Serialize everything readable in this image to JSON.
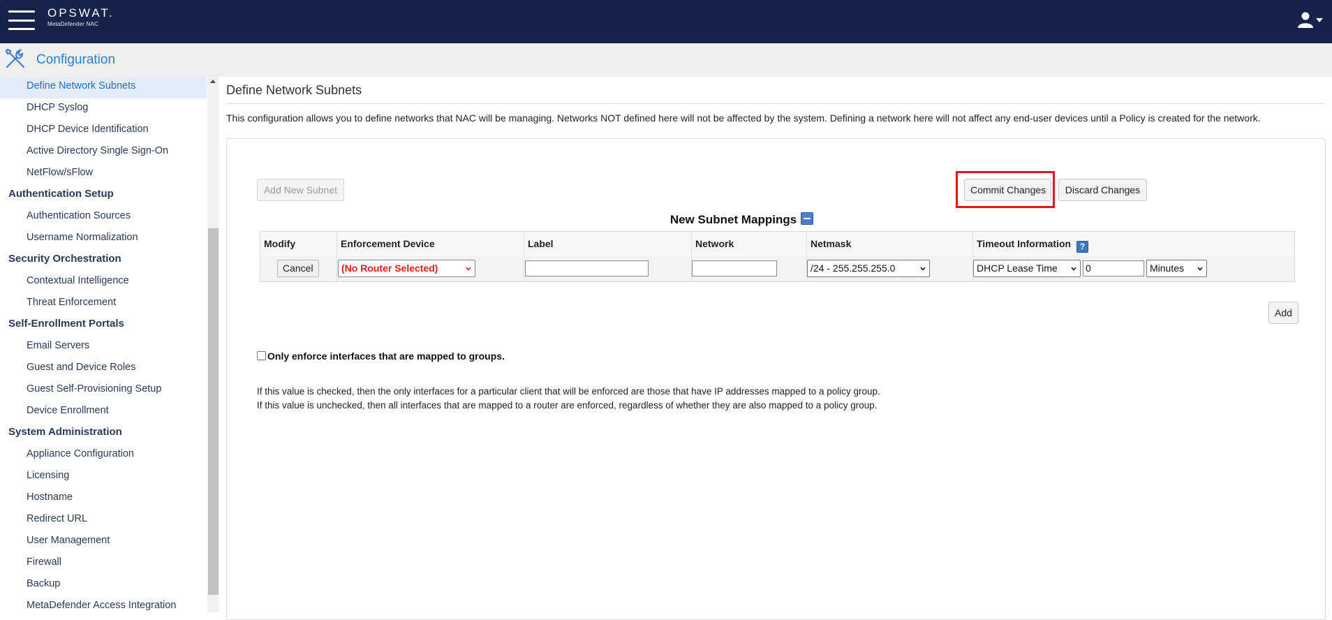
{
  "topbar": {
    "brand_name": "OPSWAT.",
    "brand_subtitle": "MetaDefender NAC",
    "menu_icon": "hamburger-icon",
    "user_icon": "user-icon"
  },
  "page_header": {
    "title": "Configuration",
    "icon": "tools-icon"
  },
  "sidebar": {
    "items": [
      {
        "label": "Define Network Subnets",
        "kind": "sub",
        "active": true
      },
      {
        "label": "DHCP Syslog",
        "kind": "sub"
      },
      {
        "label": "DHCP Device Identification",
        "kind": "sub"
      },
      {
        "label": "Active Directory Single Sign-On",
        "kind": "sub"
      },
      {
        "label": "NetFlow/sFlow",
        "kind": "sub"
      },
      {
        "label": "Authentication Setup",
        "kind": "section"
      },
      {
        "label": "Authentication Sources",
        "kind": "sub"
      },
      {
        "label": "Username Normalization",
        "kind": "sub"
      },
      {
        "label": "Security Orchestration",
        "kind": "section"
      },
      {
        "label": "Contextual Intelligence",
        "kind": "sub"
      },
      {
        "label": "Threat Enforcement",
        "kind": "sub"
      },
      {
        "label": "Self-Enrollment Portals",
        "kind": "section"
      },
      {
        "label": "Email Servers",
        "kind": "sub"
      },
      {
        "label": "Guest and Device Roles",
        "kind": "sub"
      },
      {
        "label": "Guest Self-Provisioning Setup",
        "kind": "sub"
      },
      {
        "label": "Device Enrollment",
        "kind": "sub"
      },
      {
        "label": "System Administration",
        "kind": "section"
      },
      {
        "label": "Appliance Configuration",
        "kind": "sub"
      },
      {
        "label": "Licensing",
        "kind": "sub"
      },
      {
        "label": "Hostname",
        "kind": "sub"
      },
      {
        "label": "Redirect URL",
        "kind": "sub"
      },
      {
        "label": "User Management",
        "kind": "sub"
      },
      {
        "label": "Firewall",
        "kind": "sub"
      },
      {
        "label": "Backup",
        "kind": "sub"
      },
      {
        "label": "MetaDefender Access Integration",
        "kind": "sub"
      }
    ]
  },
  "main": {
    "title": "Define Network Subnets",
    "description": "This configuration allows you to define networks that NAC will be managing. Networks NOT defined here will not be affected by the system. Defining a network here will not affect any end-user devices until a Policy is created for the network.",
    "buttons": {
      "add_subnet": "Add New Subnet",
      "commit": "Commit Changes",
      "discard": "Discard Changes",
      "add": "Add"
    },
    "mappings_title": "New Subnet Mappings",
    "table": {
      "headers": {
        "modify": "Modify",
        "enforcement_device": "Enforcement Device",
        "label": "Label",
        "network": "Network",
        "netmask": "Netmask",
        "timeout": "Timeout Information"
      },
      "row": {
        "cancel": "Cancel",
        "enforcement_device": "(No Router Selected)",
        "label_value": "",
        "network_value": "",
        "netmask": "/24 - 255.255.255.0",
        "timeout_type": "DHCP Lease Time",
        "timeout_value": "0",
        "timeout_unit": "Minutes"
      }
    },
    "checkbox_label": "Only enforce interfaces that are mapped to groups.",
    "checkbox_checked": false,
    "help_lines": [
      "If this value is checked, then the only interfaces for a particular client that will be enforced are those that have IP addresses mapped to a policy group.",
      "If this value is unchecked, then all interfaces that are mapped to a router are enforced, regardless of whether they are also mapped to a policy group."
    ]
  },
  "colors": {
    "topbar": "#17234a",
    "accent": "#2e7fd1",
    "highlight": "#e8131b",
    "warning_text": "#e01b1b"
  }
}
